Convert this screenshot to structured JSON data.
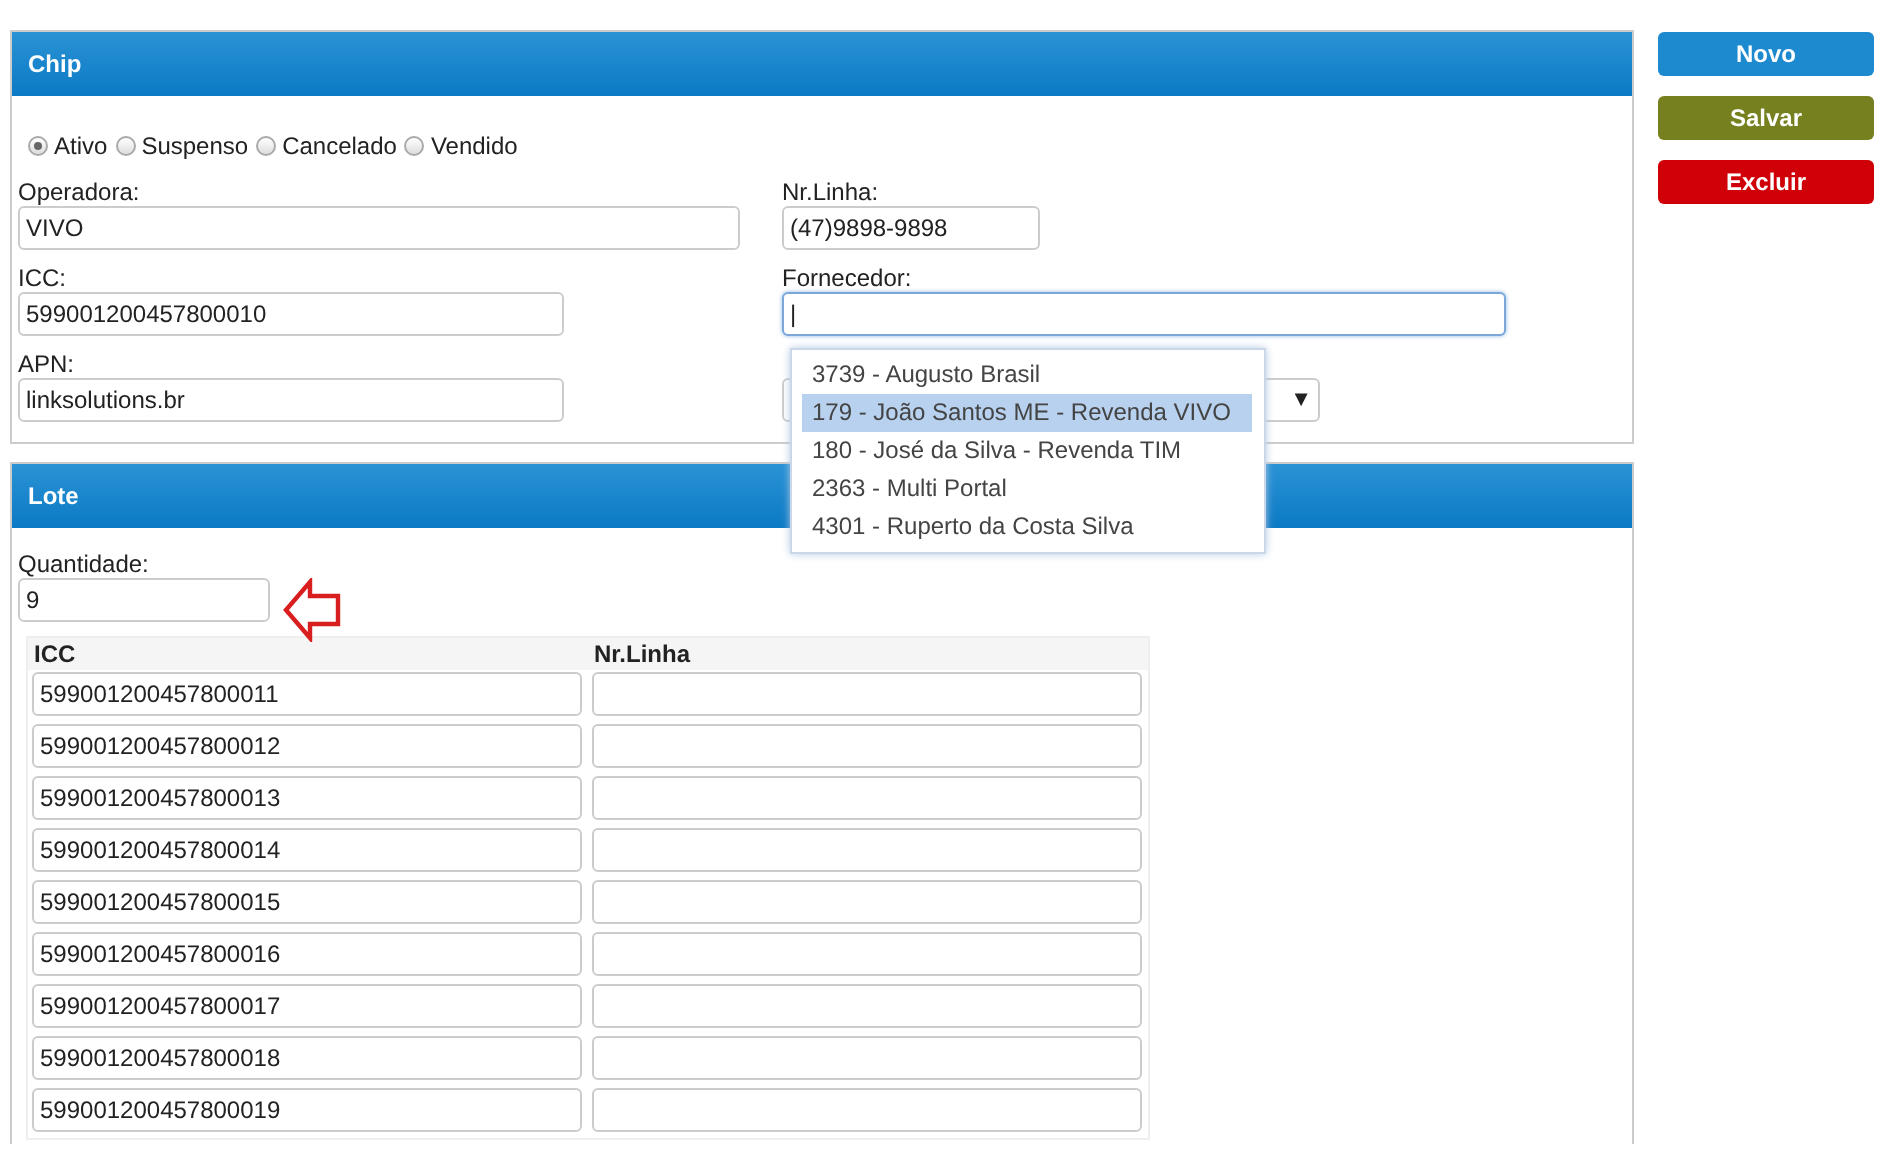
{
  "chip": {
    "title": "Chip",
    "status_options": [
      {
        "label": "Ativo",
        "selected": true
      },
      {
        "label": "Suspenso",
        "selected": false
      },
      {
        "label": "Cancelado",
        "selected": false
      },
      {
        "label": "Vendido",
        "selected": false
      }
    ],
    "operadora": {
      "label": "Operadora:",
      "value": "VIVO"
    },
    "nr_linha": {
      "label": "Nr.Linha:",
      "value": "(47)9898-9898"
    },
    "icc": {
      "label": "ICC:",
      "value": "599001200457800010"
    },
    "fornecedor": {
      "label": "Fornecedor:",
      "value": "|"
    },
    "apn": {
      "label": "APN:",
      "value": "linksolutions.br"
    },
    "select_arrow": "▼",
    "suggestions": [
      {
        "label": "3739 - Augusto Brasil",
        "selected": false
      },
      {
        "label": "179 - João Santos ME - Revenda VIVO",
        "selected": true
      },
      {
        "label": "180 - José da Silva - Revenda TIM",
        "selected": false
      },
      {
        "label": "2363 - Multi Portal",
        "selected": false
      },
      {
        "label": "4301 - Ruperto da Costa Silva",
        "selected": false
      }
    ]
  },
  "lote": {
    "title": "Lote",
    "quantidade": {
      "label": "Quantidade:",
      "value": "9"
    },
    "table": {
      "columns": [
        "ICC",
        "Nr.Linha"
      ],
      "rows": [
        [
          "599001200457800011",
          ""
        ],
        [
          "599001200457800012",
          ""
        ],
        [
          "599001200457800013",
          ""
        ],
        [
          "599001200457800014",
          ""
        ],
        [
          "599001200457800015",
          ""
        ],
        [
          "599001200457800016",
          ""
        ],
        [
          "599001200457800017",
          ""
        ],
        [
          "599001200457800018",
          ""
        ],
        [
          "599001200457800019",
          ""
        ]
      ]
    }
  },
  "buttons": [
    {
      "label": "Novo",
      "kind": "new"
    },
    {
      "label": "Salvar",
      "kind": "save"
    },
    {
      "label": "Excluir",
      "kind": "delete"
    }
  ]
}
